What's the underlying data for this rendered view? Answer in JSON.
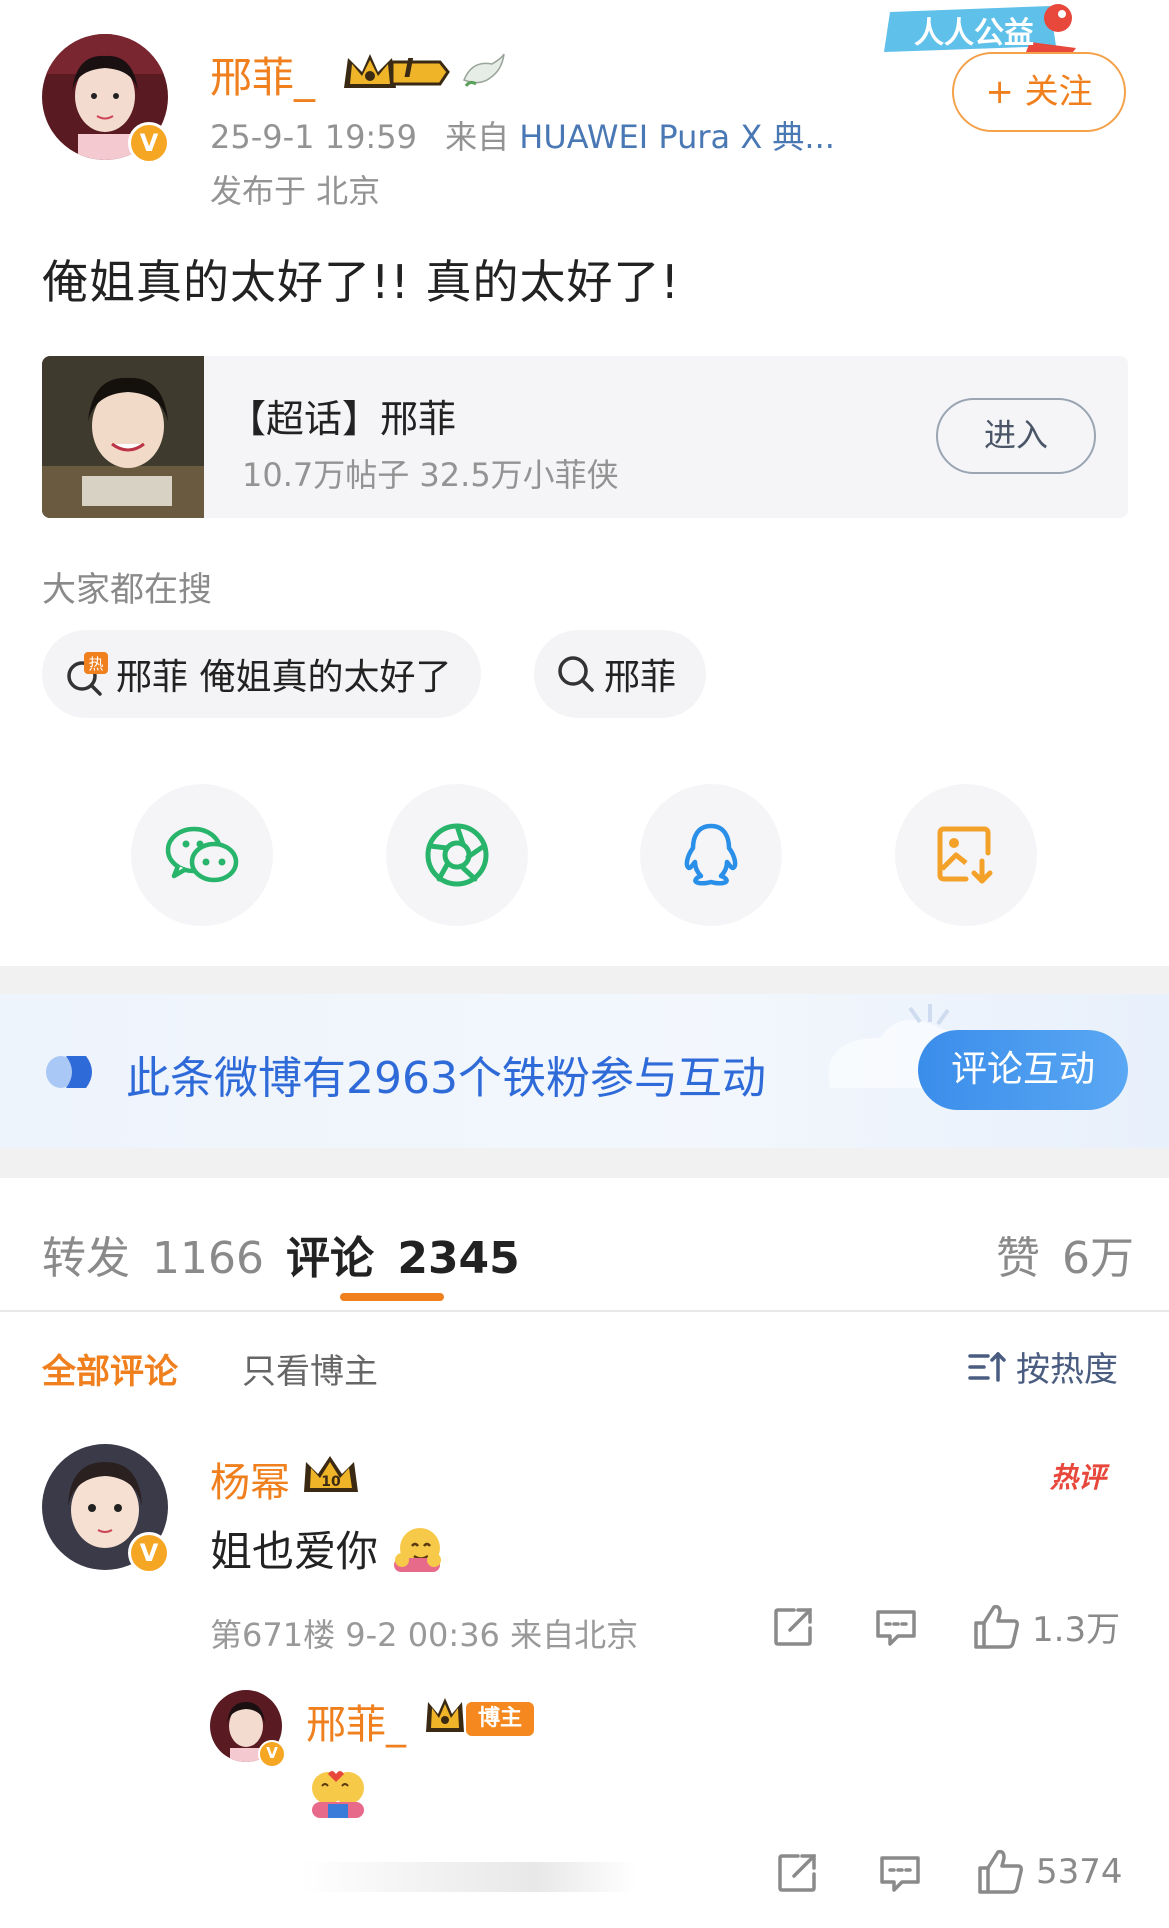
{
  "post": {
    "author": "邢菲_",
    "level_badge": "I",
    "time": "25-9-1 19:59",
    "source_prefix": "来自",
    "source_device": "HUAWEI Pura X 典...",
    "location": "发布于 北京",
    "text": "俺姐真的太好了!! 真的太好了!",
    "follow_label": "+ 关注",
    "corner_banner": "人人公益"
  },
  "topic": {
    "title": "【超话】邢菲",
    "stats": "10.7万帖子 32.5万小菲侠",
    "enter_label": "进入"
  },
  "search": {
    "label": "大家都在搜",
    "hot_mark": "热",
    "items": [
      "邢菲 俺姐真的太好了",
      "邢菲"
    ]
  },
  "share": {
    "items": [
      "wechat-icon",
      "moments-icon",
      "qq-icon",
      "save-image-icon"
    ]
  },
  "fan_banner": {
    "text": "此条微博有2963个铁粉参与互动",
    "button": "评论互动"
  },
  "tabs": {
    "repost_label": "转发",
    "repost_count": "1166",
    "comment_label": "评论",
    "comment_count": "2345",
    "like_label": "赞",
    "like_count": "6万"
  },
  "filters": {
    "all": "全部评论",
    "author_only": "只看博主",
    "sort": "按热度"
  },
  "comments": [
    {
      "name": "杨幂",
      "text": "姐也爱你",
      "hot": "热评",
      "meta": "第671楼 9-2 00:36 来自北京",
      "likes": "1.3万",
      "reply": {
        "name": "邢菲_",
        "badge": "博主",
        "likes": "5374"
      }
    }
  ],
  "colors": {
    "accent": "#f07f1e",
    "link_blue": "#2f6ad9",
    "verified": "#f5a623"
  }
}
